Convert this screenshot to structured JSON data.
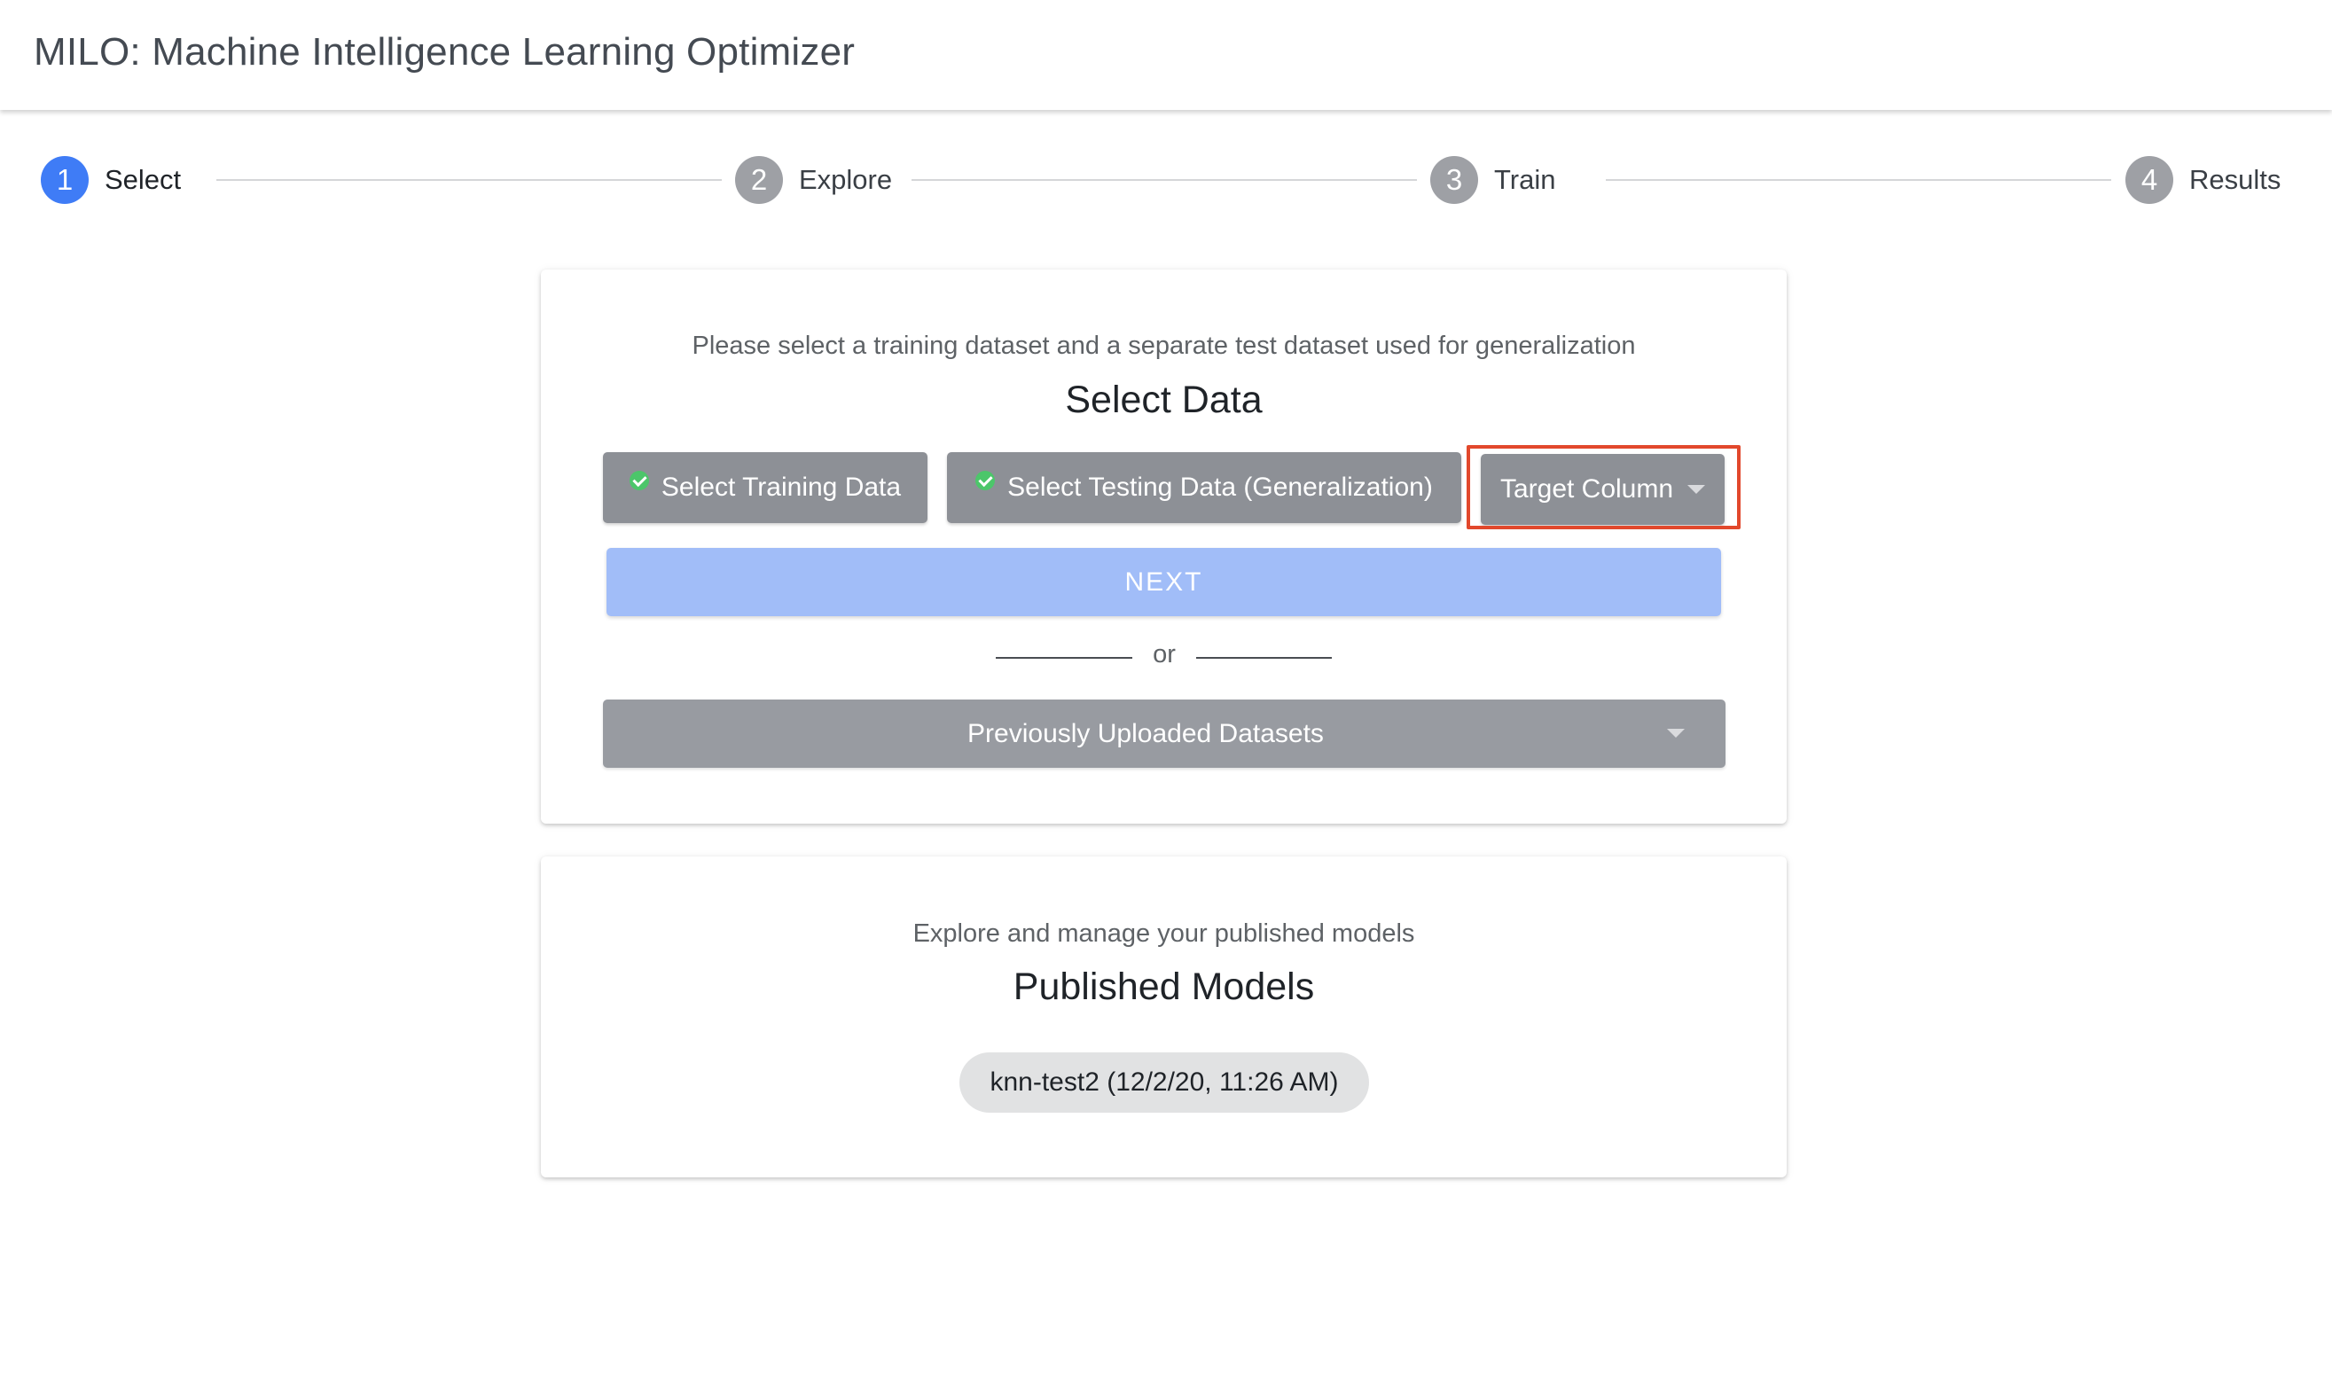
{
  "app": {
    "title": "MILO: Machine Intelligence Learning Optimizer"
  },
  "stepper": {
    "active_step": 1,
    "steps": [
      {
        "number": "1",
        "label": "Select"
      },
      {
        "number": "2",
        "label": "Explore"
      },
      {
        "number": "3",
        "label": "Train"
      },
      {
        "number": "4",
        "label": "Results"
      }
    ]
  },
  "select_card": {
    "subtitle": "Please select a training dataset and a separate test dataset used for generalization",
    "heading": "Select Data",
    "training_button": {
      "label": "Select Training Data",
      "icon": "check-circle-icon",
      "completed": true
    },
    "testing_button": {
      "label": "Select Testing Data (Generalization)",
      "icon": "check-circle-icon",
      "completed": true
    },
    "target_column": {
      "label": "Target Column",
      "icon": "caret-down-icon",
      "highlight_color": "#e2482c"
    },
    "next_button": {
      "label": "NEXT",
      "disabled": true
    },
    "divider_text": "or",
    "previous_datasets": {
      "label": "Previously Uploaded Datasets",
      "icon": "caret-down-icon"
    }
  },
  "models_card": {
    "subtitle": "Explore and manage your published models",
    "heading": "Published Models",
    "models": [
      {
        "label": "knn-test2 (12/2/20, 11:26 AM)"
      }
    ]
  },
  "colors": {
    "accent": "#3f7cf6",
    "step_inactive": "#9ea0a5",
    "button_grey": "#8d9096",
    "next_disabled": "#a1bdf8",
    "success_check": "#4cc66a"
  }
}
